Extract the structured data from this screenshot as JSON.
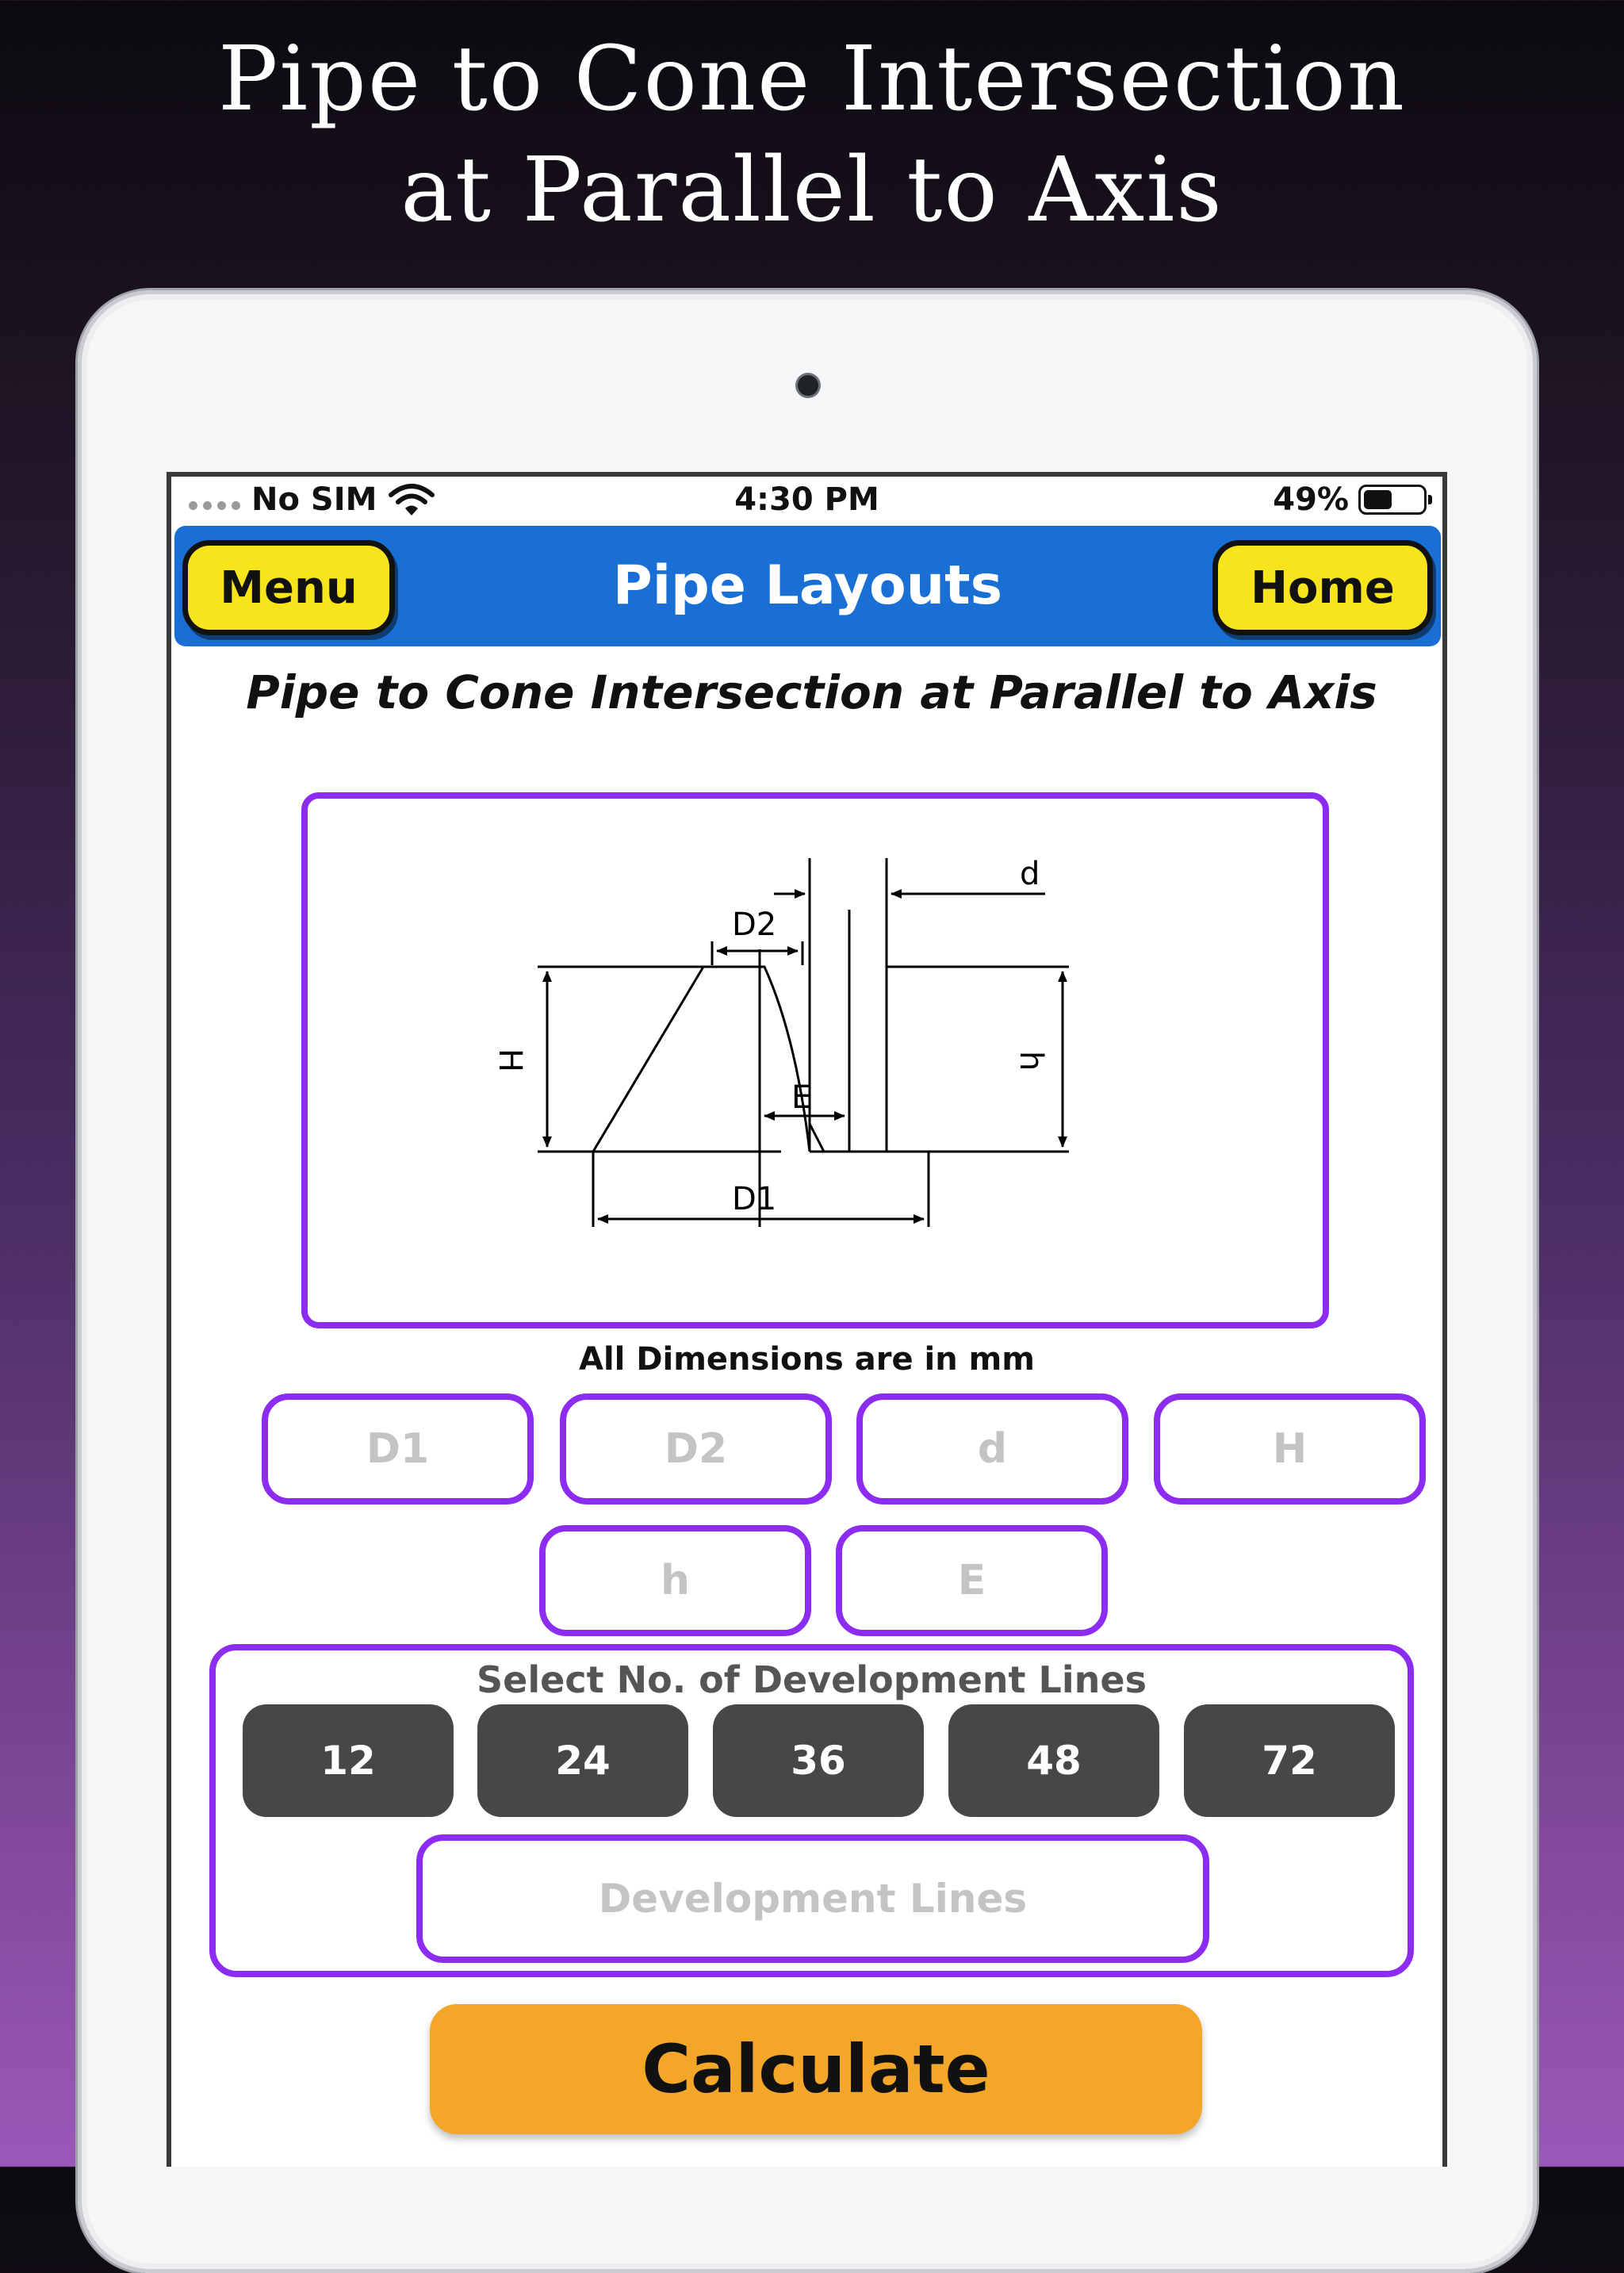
{
  "promo": {
    "line1": "Pipe to Cone Intersection",
    "line2": "at Parallel to Axis"
  },
  "status_bar": {
    "carrier": "No SIM",
    "time": "4:30 PM",
    "battery": "49%",
    "battery_level": 0.49
  },
  "navbar": {
    "menu_label": "Menu",
    "title": "Pipe Layouts",
    "home_label": "Home"
  },
  "page": {
    "title": "Pipe to Cone Intersection at Parallel to Axis"
  },
  "diagram": {
    "labels": {
      "d": "d",
      "D2": "D2",
      "H": "H",
      "h": "h",
      "E": "E",
      "D1": "D1"
    }
  },
  "units_note": "All Dimensions are in mm",
  "inputs": {
    "D1": {
      "placeholder": "D1",
      "value": ""
    },
    "D2": {
      "placeholder": "D2",
      "value": ""
    },
    "d": {
      "placeholder": "d",
      "value": ""
    },
    "H": {
      "placeholder": "H",
      "value": ""
    },
    "h": {
      "placeholder": "h",
      "value": ""
    },
    "E": {
      "placeholder": "E",
      "value": ""
    }
  },
  "development": {
    "label": "Select No. of Development Lines",
    "options": [
      "12",
      "24",
      "36",
      "48",
      "72"
    ],
    "input": {
      "placeholder": "Development Lines",
      "value": ""
    }
  },
  "calculate_label": "Calculate",
  "colors": {
    "nav_blue": "#1a6fd4",
    "nav_button_yellow": "#f7e41d",
    "accent_purple": "#8b2cf0",
    "option_gray": "#474747",
    "calculate_orange": "#f3a628"
  }
}
